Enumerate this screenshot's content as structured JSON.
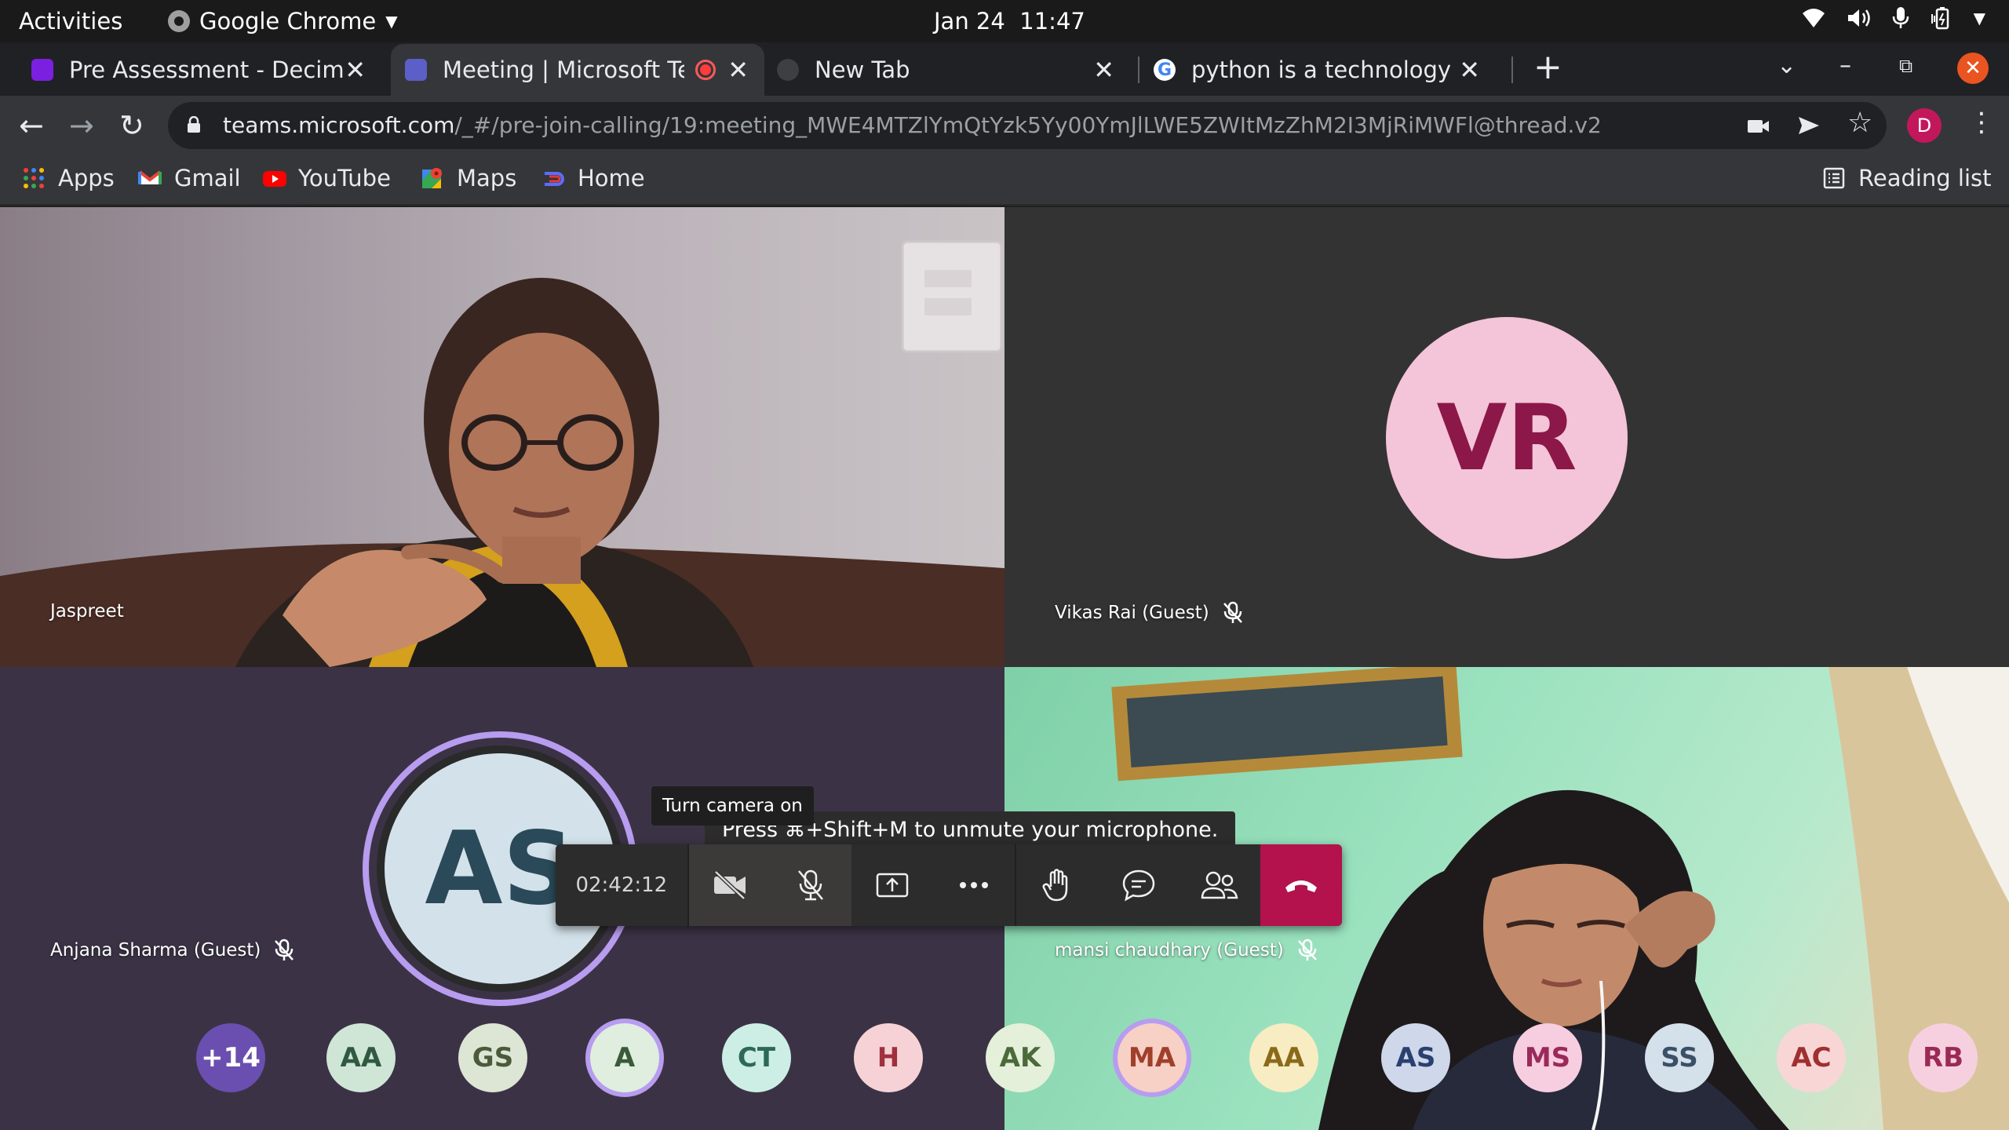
{
  "system_bar": {
    "activities": "Activities",
    "app_name": "Google Chrome",
    "date": "Jan 24",
    "time": "11:47"
  },
  "tabs": [
    {
      "title": "Pre Assessment - Decimal",
      "favicon_color": "#7b1fe0",
      "active": false
    },
    {
      "title": "Meeting | Microsoft Teams",
      "favicon_color": "#5b5fc7",
      "active": true,
      "recording": true
    },
    {
      "title": "New Tab",
      "favicon_color": "#5f6368",
      "active": false
    },
    {
      "title": "python is a technology or",
      "favicon_color": "#ffffff",
      "active": false
    }
  ],
  "omnibox": {
    "host": "teams.microsoft.com",
    "path": "/_#/pre-join-calling/19:meeting_MWE4MTZlYmQtYzk5Yy00YmJlLWE5ZWItMzZhM2I3MjRiMWFl@thread.v2"
  },
  "profile_initial": "D",
  "bookmarks": [
    {
      "label": "Apps",
      "icon": "apps-grid-icon"
    },
    {
      "label": "Gmail",
      "icon": "gmail-icon"
    },
    {
      "label": "YouTube",
      "icon": "youtube-icon"
    },
    {
      "label": "Maps",
      "icon": "maps-icon"
    },
    {
      "label": "Home",
      "icon": "home-icon"
    }
  ],
  "reading_list": "Reading list",
  "participants": {
    "jaspreet": {
      "name": "Jaspreet"
    },
    "vikas": {
      "name": "Vikas Rai (Guest)",
      "initials": "VR",
      "muted": true,
      "avatar_bg": "#f4c4d8",
      "avatar_fg": "#8b1848"
    },
    "anjana": {
      "name": "Anjana Sharma (Guest)",
      "initials": "AS",
      "muted": true,
      "avatar_bg": "#d3e2ea",
      "avatar_fg": "#2a4a5a"
    },
    "mansi": {
      "name": "mansi chaudhary (Guest)",
      "muted": true
    }
  },
  "call": {
    "timer": "02:42:12",
    "tooltip": "Turn camera on",
    "hint": "Press ⌘+Shift+M to unmute your microphone.",
    "buttons": [
      "camera-off",
      "mic-off",
      "share-screen",
      "more-actions",
      "raise-hand",
      "chat",
      "participants",
      "hang-up"
    ]
  },
  "roster": [
    {
      "initials": "+14",
      "bg": "#6a4fb0",
      "fg": "#ffffff"
    },
    {
      "initials": "AA",
      "bg": "#cfe6d7",
      "fg": "#2f5a40"
    },
    {
      "initials": "GS",
      "bg": "#dde5d4",
      "fg": "#4a5a3a"
    },
    {
      "initials": "A",
      "bg": "#dfeede",
      "fg": "#3a5a3a",
      "ring": true
    },
    {
      "initials": "CT",
      "bg": "#cdeee4",
      "fg": "#2d6a55"
    },
    {
      "initials": "H",
      "bg": "#f6d2d6",
      "fg": "#a0303e"
    },
    {
      "initials": "AK",
      "bg": "#e4f0da",
      "fg": "#4a6a3a"
    },
    {
      "initials": "MA",
      "bg": "#f7d0c6",
      "fg": "#a0402a",
      "ring": true
    },
    {
      "initials": "AA",
      "bg": "#f7ecc2",
      "fg": "#8a6a1a"
    },
    {
      "initials": "AS",
      "bg": "#cfd8ea",
      "fg": "#2a4070"
    },
    {
      "initials": "MS",
      "bg": "#f7cde0",
      "fg": "#9a2a5a"
    },
    {
      "initials": "SS",
      "bg": "#d4e0ea",
      "fg": "#3a5068"
    },
    {
      "initials": "AC",
      "bg": "#f9d6d6",
      "fg": "#a03030"
    },
    {
      "initials": "RB",
      "bg": "#f7d0e0",
      "fg": "#9a2a55"
    }
  ]
}
